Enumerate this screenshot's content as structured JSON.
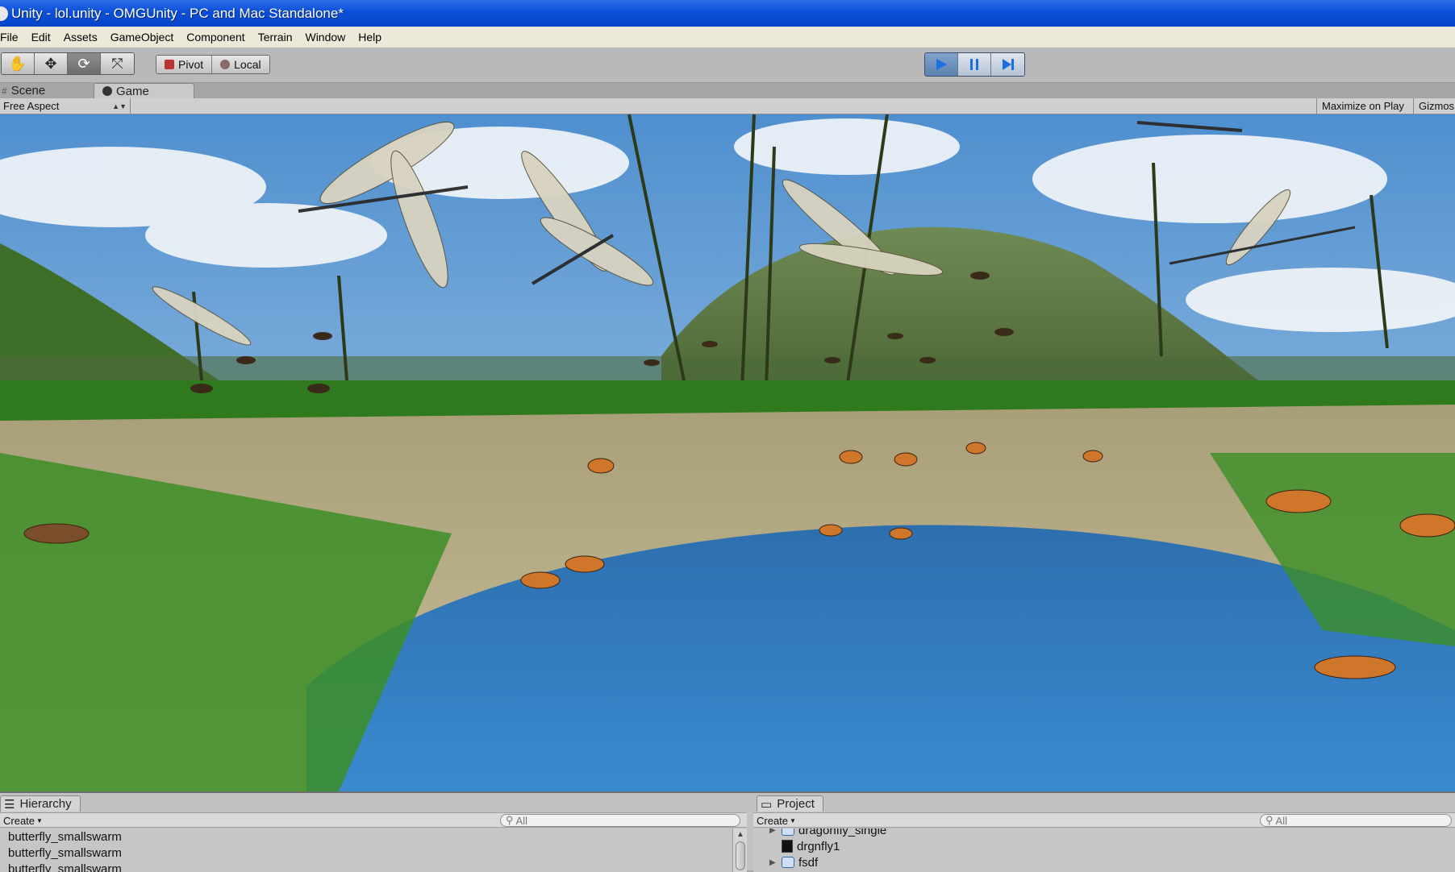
{
  "window": {
    "title": "Unity - lol.unity - OMGUnity - PC and Mac Standalone*"
  },
  "menu": [
    "File",
    "Edit",
    "Assets",
    "GameObject",
    "Component",
    "Terrain",
    "Window",
    "Help"
  ],
  "toolbar": {
    "tools": [
      {
        "name": "hand-tool",
        "glyph": "✋"
      },
      {
        "name": "move-tool",
        "glyph": "✥"
      },
      {
        "name": "rotate-tool",
        "glyph": "⟳"
      },
      {
        "name": "scale-tool",
        "glyph": "⤧"
      }
    ],
    "pivot_label": "Pivot",
    "local_label": "Local",
    "play_state": "playing"
  },
  "tabs": {
    "scene": "Scene",
    "game": "Game"
  },
  "game_view": {
    "aspect": "Free Aspect",
    "maximize_on_play": "Maximize on Play",
    "gizmos": "Gizmos"
  },
  "hierarchy": {
    "tab_label": "Hierarchy",
    "create_label": "Create",
    "search_placeholder": "All",
    "items": [
      "butterfly_smallswarm",
      "butterfly_smallswarm",
      "butterfly_smallswarm"
    ]
  },
  "project": {
    "tab_label": "Project",
    "create_label": "Create",
    "search_placeholder": "All",
    "items": [
      {
        "label": "dragonfly_single",
        "type": "prefab",
        "expandable": true
      },
      {
        "label": "drgnfly1",
        "type": "material",
        "expandable": false
      },
      {
        "label": "fsdf",
        "type": "prefab",
        "expandable": true
      }
    ]
  },
  "colors": {
    "titlebar": "#0a4fd8",
    "sky": "#7fb0dc",
    "water": "#2f78c0",
    "grass": "#2f7a1c",
    "play_active": "#5c82ad"
  }
}
